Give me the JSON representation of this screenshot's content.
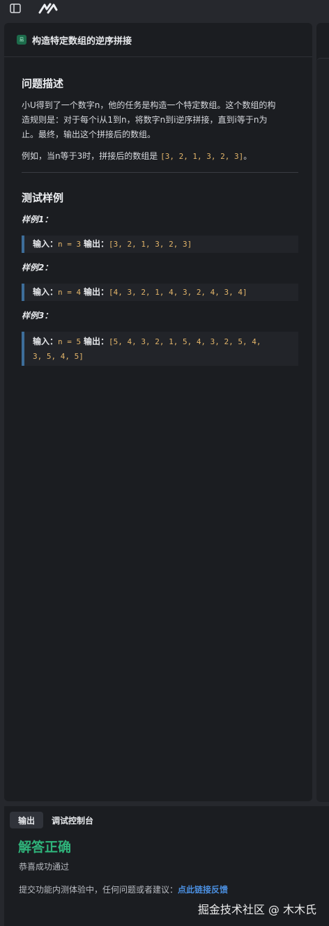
{
  "problem": {
    "title": "构造特定数组的逆序拼接",
    "difficulty_badge": "易",
    "description_heading": "问题描述",
    "description_line1": "小U得到了一个数字n，他的任务是构造一个特定数组。这个数组的构",
    "description_line2": "造规则是：对于每个i从1到n，将数字n到i逆序拼接，直到i等于n为",
    "description_line3": "止。最终，输出这个拼接后的数组。",
    "example_prefix": "例如，当n等于3时，拼接后的数组是",
    "example_code": "[3, 2, 1, 3, 2, 3]",
    "example_suffix": "。",
    "samples_heading": "测试样例",
    "input_label": "输入：",
    "output_label": "输出：",
    "samples": [
      {
        "label": "样例1：",
        "input": "n = 3",
        "output": "[3, 2, 1, 3, 2, 3]"
      },
      {
        "label": "样例2：",
        "input": "n = 4",
        "output": "[4, 3, 2, 1, 4, 3, 2, 4, 3, 4]"
      },
      {
        "label": "样例3：",
        "input": "n = 5",
        "output_line1": "[5, 4, 3, 2, 1, 5, 4, 3, 2, 5, 4,",
        "output_line2": "3, 5, 4, 5]"
      }
    ]
  },
  "bottom_panel": {
    "tabs": [
      "输出",
      "调试控制台"
    ],
    "active_tab": "输出",
    "result_title": "解答正确",
    "result_subtitle": "恭喜成功通过",
    "feedback_text": "提交功能内测体验中，任何问题或者建议：",
    "feedback_link": "点此链接反馈"
  },
  "watermark": "掘金技术社区 @ 木木氏",
  "icons": [
    "sidebar-toggle-icon",
    "marscode-logo-icon"
  ],
  "colors": {
    "success": "#2fb37a",
    "link": "#4b8fe0",
    "code": "#e3b56a",
    "quote_border": "#3d6d99"
  }
}
